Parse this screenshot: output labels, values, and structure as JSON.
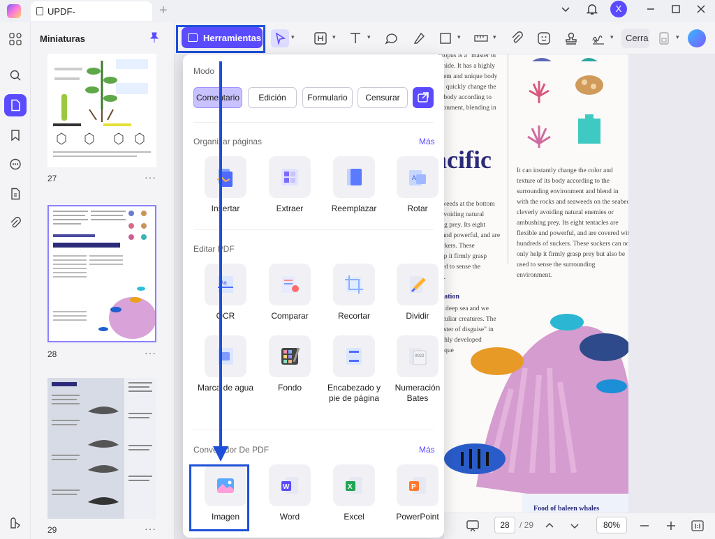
{
  "titlebar": {
    "tab_title": "UPDF-",
    "user_initial": "X"
  },
  "thumbnails": {
    "title": "Miniaturas",
    "pages": [
      {
        "number": "27"
      },
      {
        "number": "28"
      },
      {
        "number": "29"
      }
    ]
  },
  "toolbar": {
    "tools_label": "Herramientas",
    "close_label": "Cerra"
  },
  "tools_panel": {
    "mode": {
      "title": "Modo",
      "buttons": [
        "Comentario",
        "Edición",
        "Formulario",
        "Censurar"
      ]
    },
    "organize": {
      "title": "Organizar páginas",
      "more": "Más",
      "items": [
        "Insertar",
        "Extraer",
        "Reemplazar",
        "Rotar"
      ]
    },
    "edit": {
      "title": "Editar PDF",
      "items": [
        "OCR",
        "Comparar",
        "Recortar",
        "Dividir",
        "Marca de agua",
        "Fondo",
        "Encabezado y pie de página",
        "Numeración Bates"
      ]
    },
    "convert": {
      "title": "Convertidor De PDF",
      "more": "Más",
      "items": [
        "Imagen",
        "Word",
        "Excel",
        "PowerPoint"
      ]
    }
  },
  "document": {
    "heading": "acific",
    "paragraph_left": "octopus is a \"master of\nto hide. It has a highly\nystem and unique body\nt to quickly change the\nits body according to\nvironment, blending in",
    "paragraph_right": "It can instantly change the color and\ntexture of its body according to the\nsurrounding environment and blend in\nwith the rocks and seaweeds on the seabed,\ncleverly avoiding natural enemies or\nambushing prey. Its eight tentacles are\nflexible and powerful, and are covered with\nhundreds of suckers. These suckers can not\nonly help it firmly grasp prey but also be\nused to sense the surrounding\nenvironment.",
    "paragraph_left2": "eaweeds at the bottom\ny avoiding natural\nhing prey. Its eight\nle and powerful, and are\nsuckers. These\nhelp it firmly grasp\nused to sense the\nent.",
    "subheading": "loration",
    "paragraph_left3": "the deep sea and we\npeculiar creatures. The\nmaster of disguise\" in\nhighly developed\nunique",
    "footer_heading": "Food of baleen whales"
  },
  "pager": {
    "current": "28",
    "total": "/ 29",
    "zoom": "80%"
  },
  "colors": {
    "accent": "#5b4bff",
    "highlight": "#1d4fd8"
  }
}
